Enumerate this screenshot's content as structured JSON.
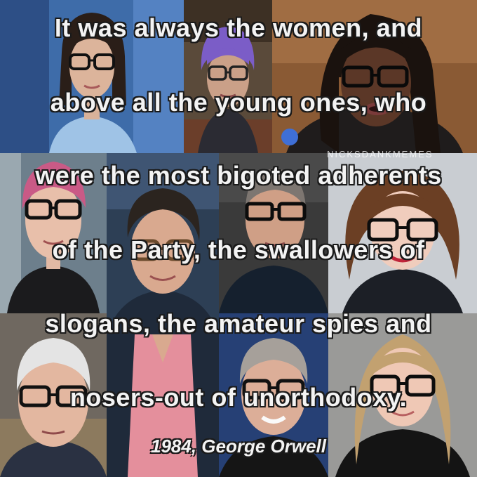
{
  "quote": {
    "lines": [
      "It was always the women, and",
      "above all the young ones, who",
      "were the most bigoted adherents",
      "of the Party, the swallowers of",
      "slogans, the amateur spies and",
      "nosers-out of unorthodoxy."
    ],
    "attribution": "1984, George Orwell"
  },
  "watermark": "NICKSDANKMEMES",
  "photos": [
    {
      "subject": "woman with dark bob hair and black glasses, light blue blouse",
      "bg": "#3e6ca9"
    },
    {
      "subject": "older woman with purple hair and glasses",
      "bg": "#5a4a3a"
    },
    {
      "subject": "woman with long dark hair and black glasses speaking",
      "bg": "#8a5a34"
    },
    {
      "subject": "person with pink hair and black glasses",
      "bg": "#6d7f8c"
    },
    {
      "subject": "person with short dark hair and tortoiseshell glasses",
      "bg": "#2d3f55"
    },
    {
      "subject": "man with grey hair and black glasses, dark shirt",
      "bg": "#3a3a3a"
    },
    {
      "subject": "woman with curly brown hair and black glasses",
      "bg": "#c9cdd2"
    },
    {
      "subject": "older man with white hair and black glasses",
      "bg": "#6f6860"
    },
    {
      "subject": "person with short grey hair and black glasses",
      "bg": "#20304a"
    },
    {
      "subject": "woman with blonde hair and black glasses",
      "bg": "#9a9a98"
    }
  ]
}
